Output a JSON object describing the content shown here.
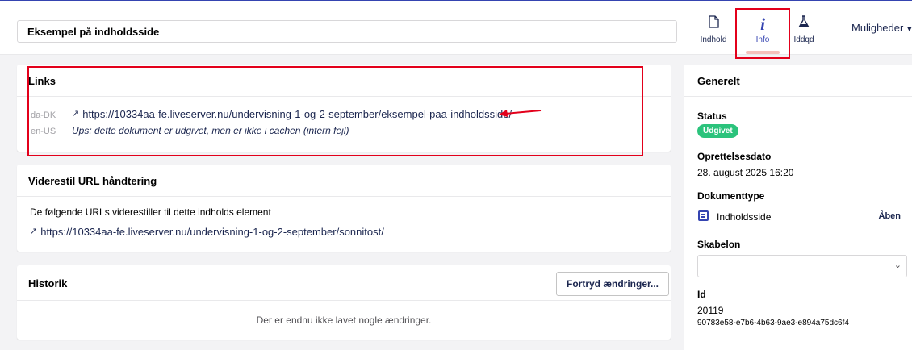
{
  "header": {
    "node_name": "Eksempel på indholdsside",
    "apps": [
      {
        "label": "Indhold",
        "icon": "document-icon"
      },
      {
        "label": "Info",
        "icon": "info-icon"
      },
      {
        "label": "Iddqd",
        "icon": "flask-icon"
      }
    ],
    "options_label": "Muligheder"
  },
  "links_card": {
    "title": "Links",
    "rows": [
      {
        "culture": "da-DK",
        "url": "https://10334aa-fe.liveserver.nu/undervisning-1-og-2-september/eksempel-paa-indholdsside/"
      },
      {
        "culture": "en-US",
        "note": "Ups: dette dokument er udgivet, men er ikke i cachen (intern fejl)"
      }
    ]
  },
  "redirect_card": {
    "title": "Viderestil URL håndtering",
    "description": "De følgende URLs viderestiller til dette indholds element",
    "url": "https://10334aa-fe.liveserver.nu/undervisning-1-og-2-september/sonnitost/"
  },
  "history_card": {
    "title": "Historik",
    "rollback_label": "Fortryd ændringer...",
    "empty_text": "Der er endnu ikke lavet nogle ændringer."
  },
  "general": {
    "title": "Generelt",
    "status_label": "Status",
    "status_value": "Udgivet",
    "created_label": "Oprettelsesdato",
    "created_value": "28. august 2025 16:20",
    "doctype_label": "Dokumenttype",
    "doctype_value": "Indholdsside",
    "open_label": "Åben",
    "template_label": "Skabelon",
    "template_value": "",
    "id_label": "Id",
    "id_value": "20119",
    "guid_value": "90783e58-e7b6-4b63-9ae3-e894a75dc6f4"
  },
  "colors": {
    "accent": "#3544b1",
    "badge_green": "#2bc37c",
    "highlight_red": "#e3001b",
    "active_underline": "#f5c1bc"
  }
}
